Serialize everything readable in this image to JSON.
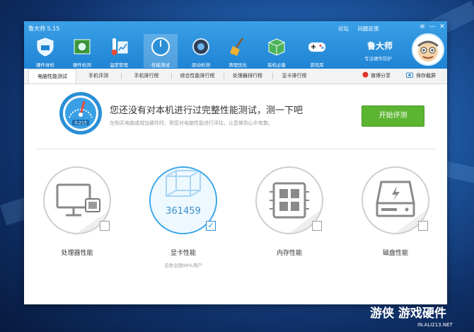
{
  "app": {
    "title": "鲁大师 5.15"
  },
  "top_links": [
    "论坛",
    "问题反馈"
  ],
  "window_controls": [
    "≡",
    "—",
    "✕"
  ],
  "nav": [
    {
      "label": "硬件体检",
      "icon": "shield-icon",
      "active": false
    },
    {
      "label": "硬件检测",
      "icon": "chip-board-icon",
      "active": false
    },
    {
      "label": "温度管理",
      "icon": "thermometer-icon",
      "active": false
    },
    {
      "label": "性能测试",
      "icon": "speedometer-icon",
      "active": true
    },
    {
      "label": "驱动检测",
      "icon": "gear-icon",
      "active": false
    },
    {
      "label": "清理优化",
      "icon": "broom-icon",
      "active": false
    },
    {
      "label": "装机必备",
      "icon": "box-icon",
      "active": false
    },
    {
      "label": "游戏库",
      "icon": "gamepad-icon",
      "active": false
    }
  ],
  "brand": {
    "name": "鲁大师",
    "slogan": "专注硬件防护"
  },
  "tabs": [
    {
      "label": "电脑性能测试",
      "active": true
    },
    {
      "label": "手机评测",
      "active": false
    },
    {
      "label": "手机排行榜",
      "active": false
    },
    {
      "label": "综合性能排行榜",
      "active": false
    },
    {
      "label": "处理器排行榜",
      "active": false
    },
    {
      "label": "显卡排行榜",
      "active": false
    }
  ],
  "right_actions": {
    "share": "微博分享",
    "save": "保存截屏"
  },
  "hero": {
    "dial_text": "0,213",
    "title": "您还没有对本机进行过完整性能测试，测一下吧",
    "subtitle": "在购买电脑或增加硬件时，帮您对电脑性能进行评估，让您做到心中有数。",
    "start_button": "开始评测"
  },
  "items": [
    {
      "label": "处理器性能",
      "icon": "monitor-cpu-icon",
      "checked": false,
      "score": "",
      "note": ""
    },
    {
      "label": "显卡性能",
      "icon": "3d-cube-icon",
      "checked": true,
      "score": "361459",
      "note": "击败全国99%用户"
    },
    {
      "label": "内存性能",
      "icon": "memory-chip-icon",
      "checked": false,
      "score": "",
      "note": ""
    },
    {
      "label": "磁盘性能",
      "icon": "hard-disk-icon",
      "checked": false,
      "score": "",
      "note": ""
    }
  ],
  "watermark": {
    "main": "游侠 游戏硬件",
    "sub": "IN.ALI213.NET"
  },
  "colors": {
    "accent": "#1f84d4",
    "start_green": "#5cb531",
    "checked_blue": "#3aa6e8"
  }
}
